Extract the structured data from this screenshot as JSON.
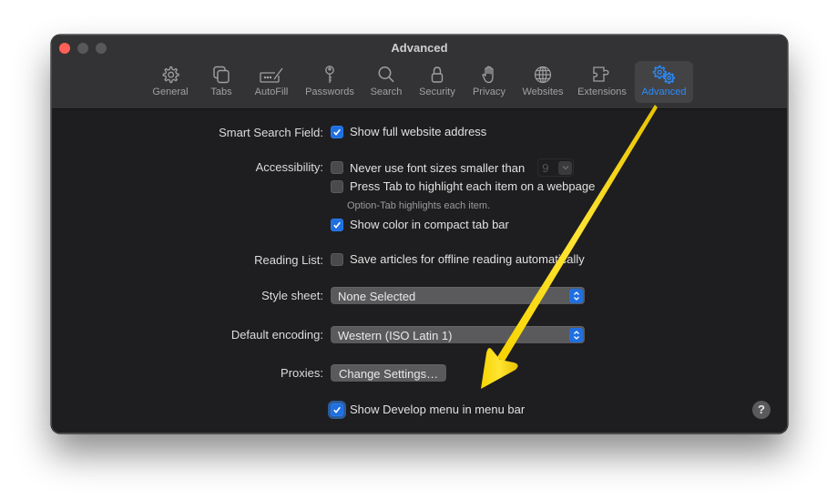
{
  "window": {
    "title": "Advanced",
    "traffic_lights": [
      "close",
      "minimize",
      "zoom"
    ]
  },
  "toolbar": {
    "items": [
      {
        "label": "General",
        "icon": "gear-icon"
      },
      {
        "label": "Tabs",
        "icon": "tabs-icon"
      },
      {
        "label": "AutoFill",
        "icon": "autofill-icon"
      },
      {
        "label": "Passwords",
        "icon": "key-icon"
      },
      {
        "label": "Search",
        "icon": "magnifier-icon"
      },
      {
        "label": "Security",
        "icon": "lock-icon"
      },
      {
        "label": "Privacy",
        "icon": "hand-icon"
      },
      {
        "label": "Websites",
        "icon": "globe-icon"
      },
      {
        "label": "Extensions",
        "icon": "puzzle-icon"
      },
      {
        "label": "Advanced",
        "icon": "gears-icon",
        "active": true
      }
    ],
    "accent_color": "#2a8cff"
  },
  "settings": {
    "smart_search": {
      "label": "Smart Search Field:",
      "option": "Show full website address",
      "checked": true
    },
    "accessibility": {
      "label": "Accessibility:",
      "min_font": {
        "option": "Never use font sizes smaller than",
        "checked": false,
        "value": "9"
      },
      "press_tab": {
        "option": "Press Tab to highlight each item on a webpage",
        "checked": false
      },
      "hint": "Option-Tab highlights each item.",
      "compact_color": {
        "option": "Show color in compact tab bar",
        "checked": true
      }
    },
    "reading_list": {
      "label": "Reading List:",
      "option": "Save articles for offline reading automatically",
      "checked": false
    },
    "style_sheet": {
      "label": "Style sheet:",
      "value": "None Selected"
    },
    "encoding": {
      "label": "Default encoding:",
      "value": "Western (ISO Latin 1)"
    },
    "proxies": {
      "label": "Proxies:",
      "button": "Change Settings…"
    },
    "develop_menu": {
      "option": "Show Develop menu in menu bar",
      "checked": true
    }
  },
  "help": {
    "label": "?"
  },
  "annotation": {
    "type": "arrow",
    "color": "#f5d100",
    "points_to": "Show Develop menu in menu bar",
    "from": "Advanced"
  }
}
